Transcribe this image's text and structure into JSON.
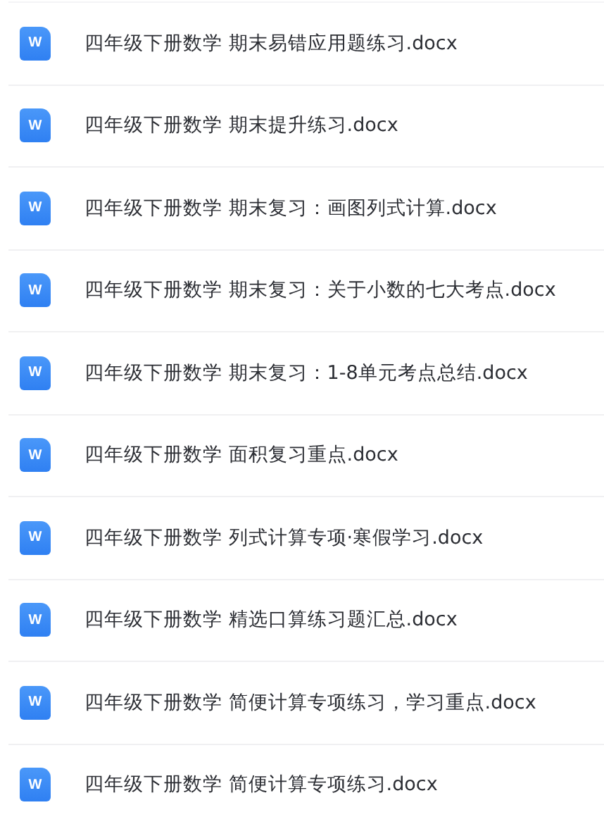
{
  "files": [
    {
      "icon_letter": "W",
      "name": "四年级下册数学 期末易错应用题练习.docx"
    },
    {
      "icon_letter": "W",
      "name": "四年级下册数学 期末提升练习.docx"
    },
    {
      "icon_letter": "W",
      "name": "四年级下册数学 期末复习：画图列式计算.docx"
    },
    {
      "icon_letter": "W",
      "name": "四年级下册数学 期末复习：关于小数的七大考点.docx"
    },
    {
      "icon_letter": "W",
      "name": "四年级下册数学 期末复习：1-8单元考点总结.docx"
    },
    {
      "icon_letter": "W",
      "name": "四年级下册数学 面积复习重点.docx"
    },
    {
      "icon_letter": "W",
      "name": "四年级下册数学 列式计算专项·寒假学习.docx"
    },
    {
      "icon_letter": "W",
      "name": "四年级下册数学 精选口算练习题汇总.docx"
    },
    {
      "icon_letter": "W",
      "name": "四年级下册数学 简便计算专项练习，学习重点.docx"
    },
    {
      "icon_letter": "W",
      "name": "四年级下册数学 简便计算专项练习.docx"
    }
  ]
}
